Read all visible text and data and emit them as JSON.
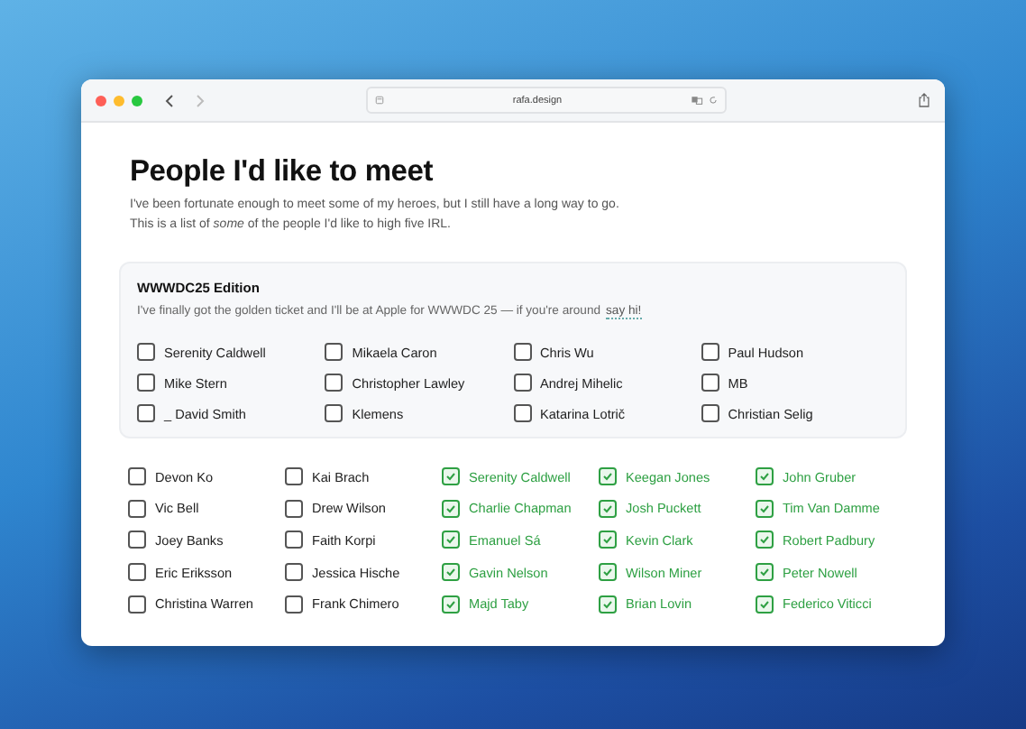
{
  "browser": {
    "address": "rafa.design"
  },
  "page": {
    "title": "People I'd like to meet",
    "intro": [
      "I've been fortunate enough to meet some of my heroes, but I still have a long way to go.",
      "This is a list of *some* of the people I'd like to high five IRL."
    ]
  },
  "edition": {
    "title": "WWWDC25 Edition",
    "description": "I've finally got the golden ticket and I'll be at Apple for WWWDC 25 — if you're around",
    "link": "say hi!",
    "people": [
      {
        "name": "Serenity Caldwell",
        "checked": false
      },
      {
        "name": "Mikaela Caron",
        "checked": false
      },
      {
        "name": "Chris Wu",
        "checked": false
      },
      {
        "name": "Paul Hudson",
        "checked": false
      },
      {
        "name": "Mike Stern",
        "checked": false
      },
      {
        "name": "Christopher Lawley",
        "checked": false
      },
      {
        "name": "Andrej Mihelic",
        "checked": false
      },
      {
        "name": "MB",
        "checked": false
      },
      {
        "name": "_ David Smith",
        "checked": false
      },
      {
        "name": "Klemens",
        "checked": false
      },
      {
        "name": "Katarina Lotrič",
        "checked": false
      },
      {
        "name": "Christian Selig",
        "checked": false
      }
    ]
  },
  "people": [
    {
      "name": "Devon Ko",
      "checked": false
    },
    {
      "name": "Kai Brach",
      "checked": false
    },
    {
      "name": "Serenity Caldwell",
      "checked": true
    },
    {
      "name": "Keegan Jones",
      "checked": true
    },
    {
      "name": "John Gruber",
      "checked": true
    },
    {
      "name": "Vic Bell",
      "checked": false
    },
    {
      "name": "Drew Wilson",
      "checked": false
    },
    {
      "name": "Charlie Chapman",
      "checked": true
    },
    {
      "name": "Josh Puckett",
      "checked": true
    },
    {
      "name": "Tim Van Damme",
      "checked": true
    },
    {
      "name": "Joey Banks",
      "checked": false
    },
    {
      "name": "Faith Korpi",
      "checked": false
    },
    {
      "name": "Emanuel Sá",
      "checked": true
    },
    {
      "name": "Kevin Clark",
      "checked": true
    },
    {
      "name": "Robert Padbury",
      "checked": true
    },
    {
      "name": "Eric Eriksson",
      "checked": false
    },
    {
      "name": "Jessica Hische",
      "checked": false
    },
    {
      "name": "Gavin Nelson",
      "checked": true
    },
    {
      "name": "Wilson Miner",
      "checked": true
    },
    {
      "name": "Peter Nowell",
      "checked": true
    },
    {
      "name": "Christina Warren",
      "checked": false
    },
    {
      "name": "Frank Chimero",
      "checked": false
    },
    {
      "name": "Majd Taby",
      "checked": true
    },
    {
      "name": "Brian Lovin",
      "checked": true
    },
    {
      "name": "Federico Viticci",
      "checked": true
    }
  ]
}
